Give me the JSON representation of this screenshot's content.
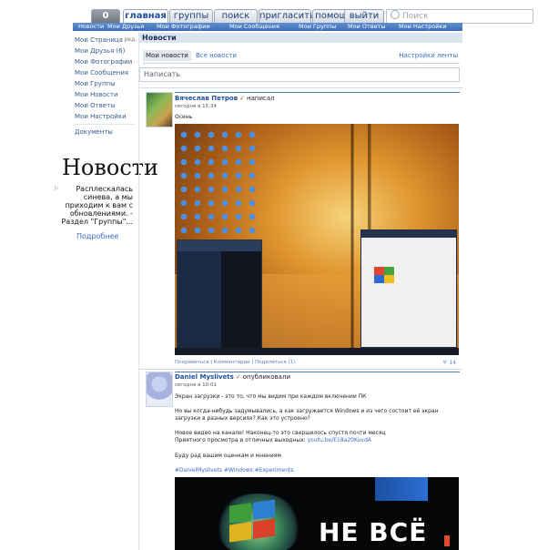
{
  "topnav": {
    "logo": "0",
    "tabs": [
      "главная",
      "группы",
      "поиск",
      "пригласить",
      "помощь",
      "выйти"
    ],
    "search_placeholder": "Поиск"
  },
  "subnav": [
    "Новости",
    "Мои Друзья",
    "Мои Фотографии",
    "Мои Сообщения",
    "Мои Группы",
    "Мои Ответы",
    "Мои Настройки"
  ],
  "sidebar": {
    "items": [
      {
        "label": "Мои Страница",
        "tag": "ред."
      },
      {
        "label": "Мои Друзья (6)"
      },
      {
        "label": "Мои Фотографии"
      },
      {
        "label": "Мои Сообщения"
      },
      {
        "label": "Мои Группы"
      },
      {
        "label": "Мои Новости"
      },
      {
        "label": "Мои Ответы"
      },
      {
        "label": "Мои Настройки"
      },
      {
        "label": "Документы"
      }
    ],
    "news_widget": {
      "title": "Новости",
      "text": "Расплескалась синева, а мы приходим к вам с обновлениями. - Раздел \"Группы\"...",
      "more": "Подробнее"
    }
  },
  "main": {
    "header": "Новости",
    "tabs": {
      "my_news": "Мои новости",
      "all_news": "Все новости",
      "settings": "Настройки ленты"
    },
    "compose_placeholder": "Написать",
    "posts": [
      {
        "author": "Вячеслав Петров",
        "verb": "написал",
        "time": "сегодня в 15:34",
        "text": "Осень",
        "actions": "Понравиться | Комментарии | Поделиться (1)",
        "likes": "14"
      },
      {
        "author": "Daniel Myslivets",
        "verb": "опубликовали",
        "time": "сегодня в 10:01",
        "paragraphs": [
          "Экран загрузки - это то, что мы видим при каждом включении ПК",
          "Но вы когда-нибудь задумывались, а как загружается Windows и из чего состоит её экран загрузки в разных версиях? Как это устроено?",
          "Новое видео на канале! Наконец-то это свершилось спустя почти месяц",
          "Приятного просмотра и отличных выходных:",
          "Буду рад вашим оценкам и мнениям"
        ],
        "link": "youtu.be/E18a20KuvdA",
        "hashtags": "#DanielMyslivets #Windows #Experiments",
        "image_text": "НЕ ВСЁ"
      }
    ]
  }
}
